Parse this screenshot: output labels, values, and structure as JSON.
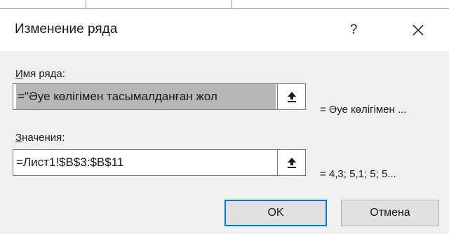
{
  "dialog": {
    "title": "Изменение ряда",
    "help_glyph": "?",
    "name_label_accel": "И",
    "name_label_rest": "мя ряда:",
    "name_value": "=\"Әуе көлігімен тасымалданған жол",
    "name_preview": "= Әуе көлігімен ...",
    "values_label_accel": "З",
    "values_label_rest": "начения:",
    "values_value": "=Лист1!$B$3:$B$11",
    "values_preview": "= 4,3; 5,1; 5; 5...",
    "ok_label": "OK",
    "cancel_label": "Отмена"
  },
  "icons": {
    "help": "help-icon",
    "close": "close-icon",
    "collapse": "collapse-dialog-icon"
  },
  "colors": {
    "dialog_bg": "#f0f0f0",
    "titlebar_bg": "#ffffff",
    "selection_bg": "#b7b7b7",
    "default_button_border": "#0078d7",
    "button_bg": "#e1e1e1"
  }
}
